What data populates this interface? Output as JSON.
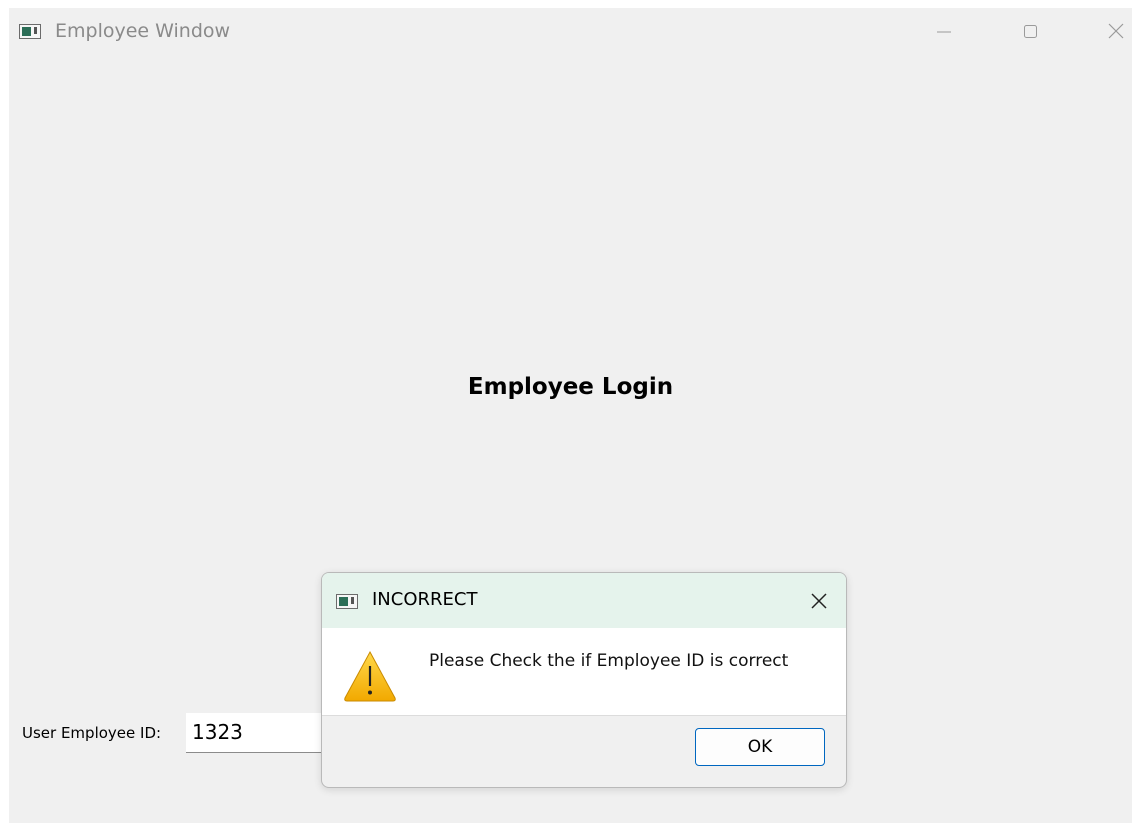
{
  "window": {
    "title": "Employee Window",
    "controls": {
      "minimize_icon": "minimize-icon",
      "maximize_icon": "maximize-icon",
      "close_icon": "close-icon"
    }
  },
  "main": {
    "heading": "Employee Login",
    "employee_id_label": "User Employee ID:",
    "employee_id_value": "1323"
  },
  "dialog": {
    "title": "INCORRECT",
    "message": "Please Check the if Employee ID is correct",
    "icon": "warning-icon",
    "ok_label": "OK"
  },
  "colors": {
    "window_bg": "#f0f0f0",
    "dialog_title_bg": "#e5f3ec",
    "ok_border": "#0067c0",
    "warning_fill": "#f7c11b"
  }
}
